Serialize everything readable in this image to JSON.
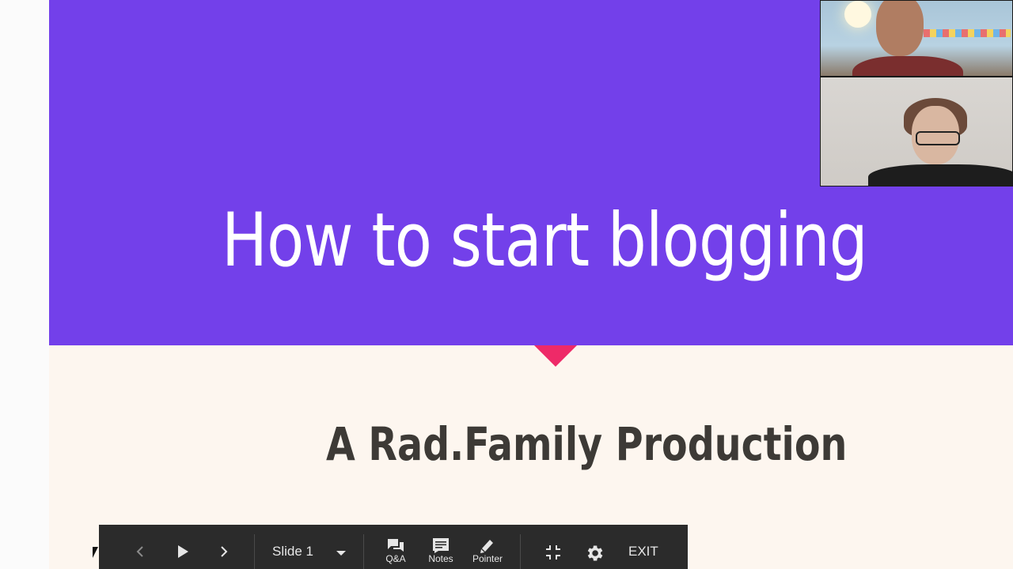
{
  "slide": {
    "title": "How to start blogging",
    "subtitle": "A Rad.Family Production",
    "colors": {
      "band": "#7340ea",
      "background": "#fdf6ef",
      "accent_triangle": "#ee2a68",
      "title_text": "#ffffff",
      "subtitle_text": "#3d3a36"
    }
  },
  "participants": [
    {
      "id": "participant-1"
    },
    {
      "id": "participant-2"
    }
  ],
  "toolbar": {
    "prev_icon": "chevron-left-icon",
    "play_icon": "play-icon",
    "next_icon": "chevron-right-icon",
    "slide_select_label": "Slide 1",
    "dropdown_icon": "caret-down-icon",
    "qa_label": "Q&A",
    "notes_label": "Notes",
    "pointer_label": "Pointer",
    "exit_fullscreen_icon": "compress-icon",
    "settings_icon": "gear-icon",
    "exit_label": "EXIT",
    "background": "#2b2b2b"
  }
}
